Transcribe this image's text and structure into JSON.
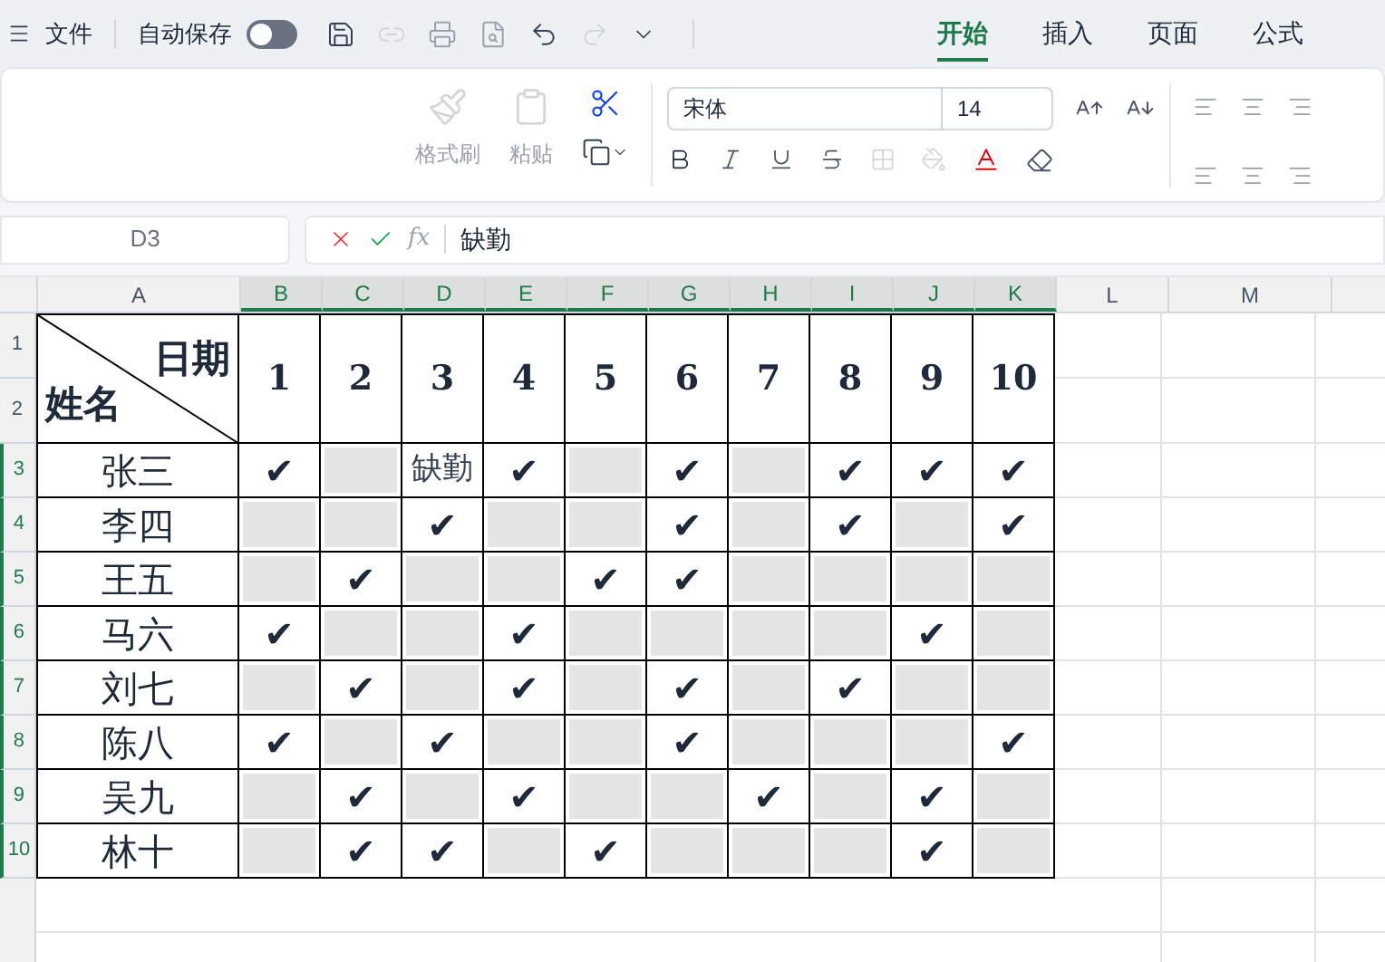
{
  "title_bar": {
    "menu": "文件",
    "autosave": {
      "label": "自动保存",
      "on": false
    }
  },
  "tabs": [
    {
      "label": "开始",
      "selected": true
    },
    {
      "label": "插入",
      "selected": false
    },
    {
      "label": "页面",
      "selected": false
    },
    {
      "label": "公式",
      "selected": false
    }
  ],
  "ribbon": {
    "format_painter": "格式刷",
    "paste": "粘贴",
    "font": "宋体",
    "font_size": "14"
  },
  "formula_bar": {
    "cell_ref": "D3",
    "fx": "fx",
    "value": "缺勤"
  },
  "columns": [
    "A",
    "B",
    "C",
    "D",
    "E",
    "F",
    "G",
    "H",
    "I",
    "J",
    "K",
    "L",
    "M"
  ],
  "row_numbers": [
    "1",
    "2",
    "3",
    "4",
    "5",
    "6",
    "7",
    "8",
    "9",
    "10"
  ],
  "table": {
    "corner_top": "日期",
    "corner_bottom": "姓名",
    "days": [
      "1",
      "2",
      "3",
      "4",
      "5",
      "6",
      "7",
      "8",
      "9",
      "10"
    ],
    "rows": [
      {
        "name": "张三",
        "cells": [
          {
            "kind": "mark",
            "text": "✔"
          },
          {
            "kind": "blank"
          },
          {
            "kind": "text",
            "text": "缺勤"
          },
          {
            "kind": "mark",
            "text": "✔"
          },
          {
            "kind": "blank"
          },
          {
            "kind": "mark",
            "text": "✔"
          },
          {
            "kind": "blank"
          },
          {
            "kind": "mark",
            "text": "✔"
          },
          {
            "kind": "mark",
            "text": "✔"
          },
          {
            "kind": "mark",
            "text": "✔"
          }
        ]
      },
      {
        "name": "李四",
        "cells": [
          {
            "kind": "blank"
          },
          {
            "kind": "blank"
          },
          {
            "kind": "mark",
            "text": "✔"
          },
          {
            "kind": "blank"
          },
          {
            "kind": "blank"
          },
          {
            "kind": "mark",
            "text": "✔"
          },
          {
            "kind": "blank"
          },
          {
            "kind": "mark",
            "text": "✔"
          },
          {
            "kind": "blank"
          },
          {
            "kind": "mark",
            "text": "✔"
          }
        ]
      },
      {
        "name": "王五",
        "cells": [
          {
            "kind": "blank"
          },
          {
            "kind": "mark",
            "text": "✔"
          },
          {
            "kind": "blank"
          },
          {
            "kind": "blank"
          },
          {
            "kind": "mark",
            "text": "✔"
          },
          {
            "kind": "mark",
            "text": "✔"
          },
          {
            "kind": "blank"
          },
          {
            "kind": "blank"
          },
          {
            "kind": "blank"
          },
          {
            "kind": "blank"
          }
        ]
      },
      {
        "name": "马六",
        "cells": [
          {
            "kind": "mark",
            "text": "✔"
          },
          {
            "kind": "blank"
          },
          {
            "kind": "blank"
          },
          {
            "kind": "mark",
            "text": "✔"
          },
          {
            "kind": "blank"
          },
          {
            "kind": "blank"
          },
          {
            "kind": "blank"
          },
          {
            "kind": "blank"
          },
          {
            "kind": "mark",
            "text": "✔"
          },
          {
            "kind": "blank"
          }
        ]
      },
      {
        "name": "刘七",
        "cells": [
          {
            "kind": "blank"
          },
          {
            "kind": "mark",
            "text": "✔"
          },
          {
            "kind": "blank"
          },
          {
            "kind": "mark",
            "text": "✔"
          },
          {
            "kind": "blank"
          },
          {
            "kind": "mark",
            "text": "✔"
          },
          {
            "kind": "blank"
          },
          {
            "kind": "mark",
            "text": "✔"
          },
          {
            "kind": "blank"
          },
          {
            "kind": "blank"
          }
        ]
      },
      {
        "name": "陈八",
        "cells": [
          {
            "kind": "mark",
            "text": "✔"
          },
          {
            "kind": "blank"
          },
          {
            "kind": "mark",
            "text": "✔"
          },
          {
            "kind": "blank"
          },
          {
            "kind": "blank"
          },
          {
            "kind": "mark",
            "text": "✔"
          },
          {
            "kind": "blank"
          },
          {
            "kind": "blank"
          },
          {
            "kind": "blank"
          },
          {
            "kind": "mark",
            "text": "✔"
          }
        ]
      },
      {
        "name": "吴九",
        "cells": [
          {
            "kind": "blank"
          },
          {
            "kind": "mark",
            "text": "✔"
          },
          {
            "kind": "blank"
          },
          {
            "kind": "mark",
            "text": "✔"
          },
          {
            "kind": "blank"
          },
          {
            "kind": "blank"
          },
          {
            "kind": "mark",
            "text": "✔"
          },
          {
            "kind": "blank"
          },
          {
            "kind": "mark",
            "text": "✔"
          },
          {
            "kind": "blank"
          }
        ]
      },
      {
        "name": "林十",
        "cells": [
          {
            "kind": "blank"
          },
          {
            "kind": "mark",
            "text": "✔"
          },
          {
            "kind": "mark",
            "text": "✔"
          },
          {
            "kind": "blank"
          },
          {
            "kind": "mark",
            "text": "✔"
          },
          {
            "kind": "blank"
          },
          {
            "kind": "blank"
          },
          {
            "kind": "blank"
          },
          {
            "kind": "mark",
            "text": "✔"
          },
          {
            "kind": "blank"
          }
        ]
      }
    ]
  }
}
